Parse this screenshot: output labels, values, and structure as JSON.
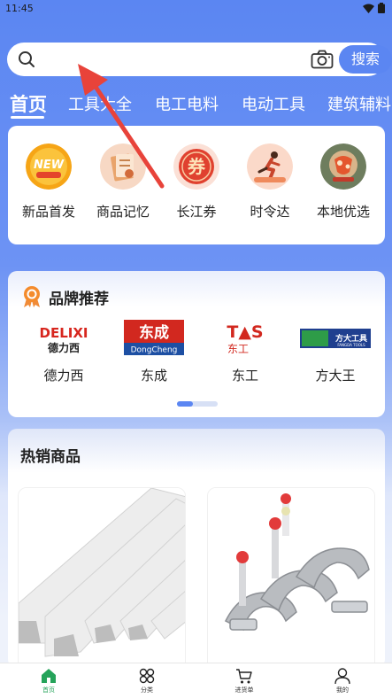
{
  "status_bar": {
    "time": "11:45"
  },
  "search": {
    "placeholder": "",
    "button_label": "搜索"
  },
  "tabs": [
    {
      "label": "首页",
      "active": true
    },
    {
      "label": "工具大全"
    },
    {
      "label": "电工电料"
    },
    {
      "label": "电动工具"
    },
    {
      "label": "建筑辅料"
    }
  ],
  "shortcuts": [
    {
      "label": "新品首发",
      "icon": "new-badge-icon",
      "icon_text": "NEW"
    },
    {
      "label": "商品记忆",
      "icon": "memo-icon"
    },
    {
      "label": "长江券",
      "icon": "coupon-icon",
      "icon_text": "券"
    },
    {
      "label": "时令达",
      "icon": "runner-icon"
    },
    {
      "label": "本地优选",
      "icon": "local-pick-icon"
    }
  ],
  "brands": {
    "title": "品牌推荐",
    "items": [
      {
        "name": "德力西",
        "logo_text": "DELIXI",
        "logo_sub": "德力西"
      },
      {
        "name": "东成",
        "logo_text": "东成",
        "logo_sub": "DongCheng"
      },
      {
        "name": "东工",
        "logo_text": "T▲S",
        "logo_sub": "东工"
      },
      {
        "name": "方大王",
        "logo_text": "方大工具",
        "logo_sub": "FANGDA TOOLS"
      }
    ]
  },
  "hot_products": {
    "title": "热销商品"
  },
  "bottom_nav": [
    {
      "label": "首页",
      "icon": "home-icon",
      "active": true
    },
    {
      "label": "分类",
      "icon": "category-icon"
    },
    {
      "label": "进货单",
      "icon": "cart-icon"
    },
    {
      "label": "我的",
      "icon": "profile-icon"
    }
  ],
  "colors": {
    "primary": "#5b86f2",
    "active_nav": "#25a35a",
    "arrow": "#e8433a"
  }
}
